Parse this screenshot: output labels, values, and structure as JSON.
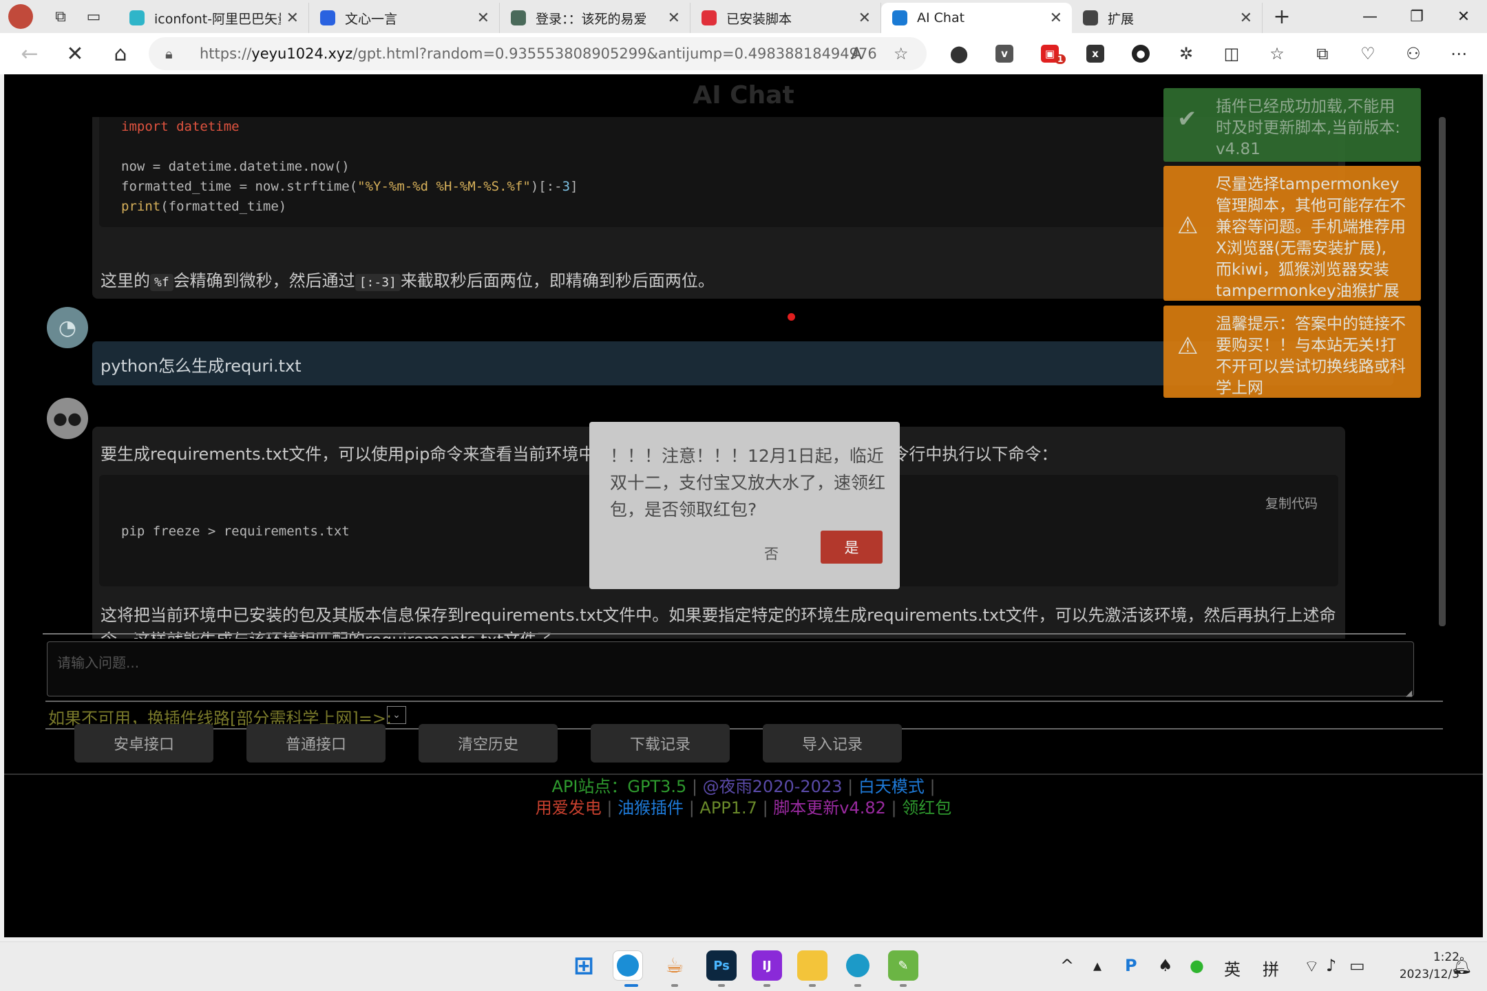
{
  "browser": {
    "tabs": [
      {
        "title": "iconfont-阿里巴巴矢量",
        "favicon_color": "#2fb5c9",
        "active": false
      },
      {
        "title": "文心一言",
        "favicon_color": "#2a62e0",
        "active": false
      },
      {
        "title": "登录：：该死的易爱",
        "favicon_color": "#4a6a5a",
        "active": false
      },
      {
        "title": "已安装脚本",
        "favicon_color": "#e0303a",
        "active": false
      },
      {
        "title": "AI Chat",
        "favicon_color": "#1a7ad4",
        "active": true
      },
      {
        "title": "扩展",
        "favicon_color": "#444444",
        "active": false
      }
    ],
    "url_prefix": "https://",
    "url_host": "yeyu1024.xyz",
    "url_path": "/gpt.html?random=0.935553808905299&antijump=0.49838818494976",
    "extension_badge": "1"
  },
  "page": {
    "title": "AI Chat",
    "code1": {
      "line0": "import datetime",
      "line1": "now = datetime.datetime.now()",
      "line2_a": "formatted_time = now.strftime(",
      "line2_b": "\"%Y-%m-%d %H-%M-%S.%f\"",
      "line2_c": ")[:-",
      "line2_d": "3",
      "line2_e": "]",
      "line3_a": "print",
      "line3_b": "(formatted_time)"
    },
    "para1": {
      "a": "这里的",
      "code_a": "%f",
      "b": "会精确到微秒，然后通过",
      "code_b": "[:-3]",
      "c": "来截取秒后面两位，即精确到秒后面两位。"
    },
    "user_question": "python怎么生成requri.txt",
    "answer_intro": "要生成requirements.txt文件，可以使用pip命令来查看当前环境中已安装的包，并将其保存到文件中。在命令行中执行以下命令：",
    "copy_code": "复制代码",
    "code2": "pip freeze > requirements.txt",
    "answer_outro_1": "这将把当前环境中已安装的包及其版本信息保存到requirements.txt文件中。如果要指定特定的环境生成requirements.txt文件，可以先激活该环境，然后再执行上述命",
    "answer_outro_2": "令。这样就能生成与该环境相匹配的requirements.txt文件了。",
    "input_placeholder": "请输入问题...",
    "line_tip": "如果不可用，换插件线路[部分需科学上网]=>:",
    "buttons": [
      "安卓接口",
      "普通接口",
      "清空历史",
      "下载记录",
      "导入记录"
    ],
    "footer_row1": [
      {
        "text": "API站点：GPT3.5",
        "color": "#2e9a2e"
      },
      {
        "text": "@夜雨2020-2023",
        "color": "#5a4aa8"
      },
      {
        "text": "白天模式",
        "color": "#1e7ad8"
      }
    ],
    "footer_row2": [
      {
        "text": "用爱发电",
        "color": "#c8402e"
      },
      {
        "text": "油猴插件",
        "color": "#1e7ad8"
      },
      {
        "text": "APP1.7",
        "color": "#6a8a2a"
      },
      {
        "text": "脚本更新v4.82",
        "color": "#9a2aa0"
      },
      {
        "text": "领红包",
        "color": "#2e9a2e"
      }
    ]
  },
  "modal": {
    "message": "！！！注意！！！12月1日起，临近双十二，支付宝又放大水了，速领红包，是否领取红包?",
    "no_label": "否",
    "yes_label": "是"
  },
  "toasts": [
    {
      "type": "success",
      "icon": "check-icon",
      "text": "插件已经成功加载,不能用时及时更新脚本,当前版本: v4.81"
    },
    {
      "type": "warning",
      "icon": "warning-icon",
      "text": "尽量选择tampermonkey管理脚本，其他可能存在不兼容等问题。手机端推荐用X浏览器(无需安装扩展), 而kiwi，狐猴浏览器安装tampermonkey油猴扩展"
    },
    {
      "type": "warning",
      "icon": "warning-icon",
      "text": "温馨提示：答案中的链接不要购买！！与本站无关!打不开可以尝试切换线路或科学上网"
    }
  ],
  "taskbar": {
    "ime_lang": "英",
    "ime_mode": "拼",
    "time": "1:22",
    "date": "2023/12/3"
  }
}
